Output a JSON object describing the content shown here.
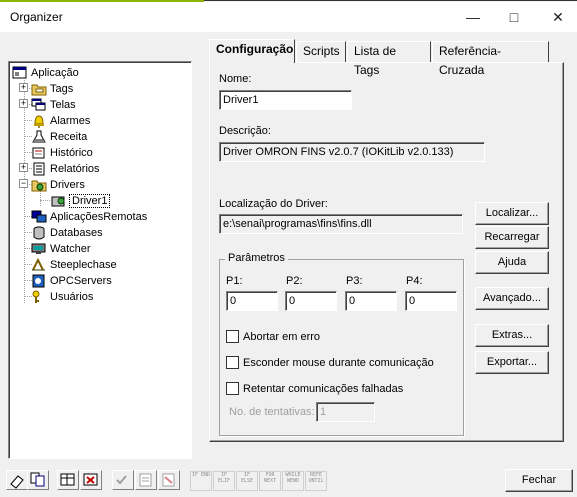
{
  "window": {
    "title": "Organizer"
  },
  "tree": {
    "items": [
      {
        "label": "Aplicação",
        "icon": "application-icon"
      },
      {
        "label": "Tags",
        "icon": "tags-folder-icon"
      },
      {
        "label": "Telas",
        "icon": "screens-icon"
      },
      {
        "label": "Alarmes",
        "icon": "alarm-bell-icon"
      },
      {
        "label": "Receita",
        "icon": "recipe-flask-icon"
      },
      {
        "label": "Histórico",
        "icon": "history-icon"
      },
      {
        "label": "Relatórios",
        "icon": "reports-icon"
      },
      {
        "label": "Drivers",
        "icon": "drivers-icon"
      },
      {
        "label": "Driver1",
        "icon": "driver-icon"
      },
      {
        "label": "AplicaçõesRemotas",
        "icon": "remote-apps-icon"
      },
      {
        "label": "Databases",
        "icon": "database-icon"
      },
      {
        "label": "Watcher",
        "icon": "watcher-icon"
      },
      {
        "label": "Steeplechase",
        "icon": "steeplechase-icon"
      },
      {
        "label": "OPCServers",
        "icon": "opc-server-icon"
      },
      {
        "label": "Usuários",
        "icon": "users-key-icon"
      }
    ]
  },
  "tabs": [
    {
      "label": "Configuração"
    },
    {
      "label": "Scripts"
    },
    {
      "label": "Lista de Tags"
    },
    {
      "label": "Referência-Cruzada"
    }
  ],
  "config": {
    "name_label": "Nome:",
    "name_value": "Driver1",
    "description_label": "Descrição:",
    "description_value": "Driver OMRON FINS v2.0.7 (IOKitLib v2.0.133)",
    "location_label": "Localização do Driver:",
    "location_value": "e:\\senai\\programas\\fins\\fins.dll",
    "params_title": "Parâmetros",
    "params": [
      {
        "label": "P1:",
        "value": "0"
      },
      {
        "label": "P2:",
        "value": "0"
      },
      {
        "label": "P3:",
        "value": "0"
      },
      {
        "label": "P4:",
        "value": "0"
      }
    ],
    "checkbox_abort": "Abortar em erro",
    "checkbox_hide_mouse": "Esconder mouse durante comunicação",
    "checkbox_retry": "Retentar comunicações falhadas",
    "retries_label": "No. de tentativas:",
    "retries_value": "1"
  },
  "buttons": {
    "localizar": "Localizar...",
    "recarregar": "Recarregar",
    "ajuda": "Ajuda",
    "avancado": "Avançado...",
    "extras": "Extras...",
    "exportar": "Exportar...",
    "fechar": "Fechar"
  },
  "toolbar_keywords": [
    "IF END",
    "IF ELIF",
    "IF ELSE",
    "FOR NEXT",
    "WHILE WEND",
    "REFE UNTIL"
  ]
}
